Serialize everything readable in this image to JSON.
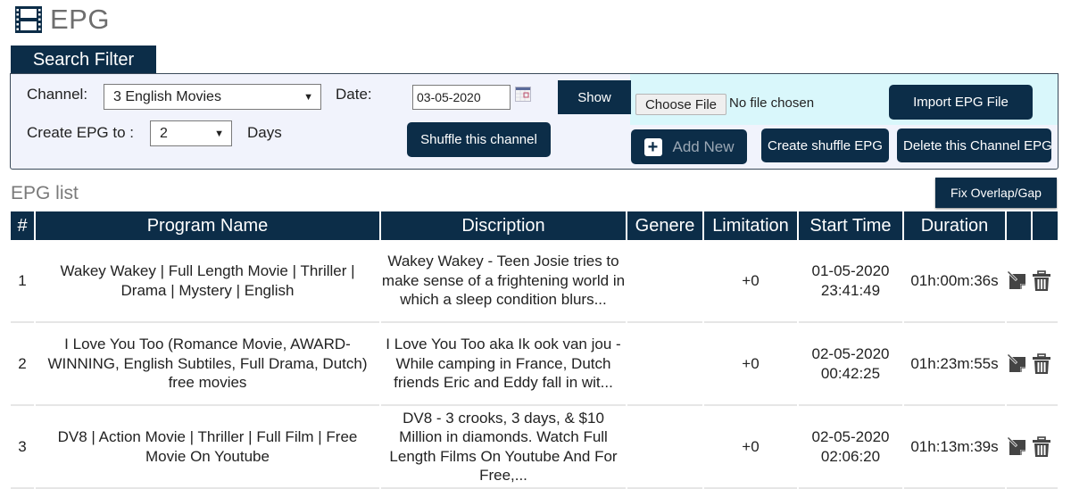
{
  "page": {
    "title": "EPG",
    "title_icon": "film-icon"
  },
  "search_filter": {
    "tab_label": "Search Filter",
    "channel_label": "Channel:",
    "channel_value": "3 English Movies",
    "date_label": "Date:",
    "date_value": "03-05-2020",
    "create_epg_label": "Create EPG to :",
    "days_value": "2",
    "days_label": "Days",
    "show_button": "Show",
    "shuffle_channel_button": "Shuffle this channel",
    "choose_file_button": "Choose File",
    "no_file_text": "No file chosen",
    "import_button": "Import EPG File",
    "add_new_button": "Add New",
    "create_shuffle_button": "Create shuffle EPG",
    "delete_channel_button": "Delete this Channel EPG"
  },
  "epg_list": {
    "title": "EPG list",
    "fix_button": "Fix Overlap/Gap",
    "columns": [
      "#",
      "Program Name",
      "Discription",
      "Genere",
      "Limitation",
      "Start Time",
      "Duration",
      "",
      ""
    ],
    "rows": [
      {
        "num": "1",
        "name": "Wakey Wakey | Full Length Movie | Thriller | Drama | Mystery | English",
        "description": "Wakey Wakey - Teen Josie tries to make sense of a frightening world in which a sleep condition blurs...",
        "genre": "",
        "limitation": "+0",
        "start_date": "01-05-2020",
        "start_time": "23:41:49",
        "duration": "01h:00m:36s"
      },
      {
        "num": "2",
        "name": "I Love You Too (Romance Movie, AWARD-WINNING, English Subtiles, Full Drama, Dutch) free movies",
        "description": "I Love You Too aka Ik ook van jou - While camping in France, Dutch friends Eric and Eddy fall in wit...",
        "genre": "",
        "limitation": "+0",
        "start_date": "02-05-2020",
        "start_time": "00:42:25",
        "duration": "01h:23m:55s"
      },
      {
        "num": "3",
        "name": "DV8 | Action Movie | Thriller | Full Film | Free Movie On Youtube",
        "description": "DV8 - 3 crooks, 3 days, & $10 Million in diamonds. Watch Full Length Films On Youtube And For Free,...",
        "genre": "",
        "limitation": "+0",
        "start_date": "02-05-2020",
        "start_time": "02:06:20",
        "duration": "01h:13m:39s"
      }
    ]
  },
  "colors": {
    "primary": "#0c2d48",
    "panel_bg": "#f1f3fc",
    "import_strip": "#d9f7fb",
    "muted_text": "#7a7a7a"
  }
}
